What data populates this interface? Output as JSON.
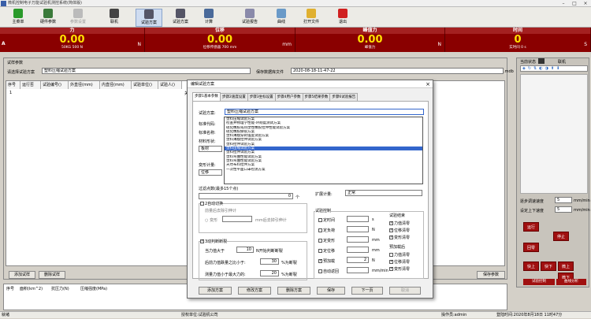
{
  "titlebar": {
    "title": "微机控制电子万能试验机测控系统(简体版)"
  },
  "toolbar": {
    "items": [
      {
        "label": "主菜单",
        "icon": "main-menu-icon"
      },
      {
        "label": "硬件参数",
        "icon": "hardware-icon"
      },
      {
        "label": "参数设置",
        "icon": "settings-icon"
      },
      {
        "label": "联机",
        "icon": "connect-icon"
      },
      {
        "label": "试验方案",
        "icon": "scheme-icon"
      },
      {
        "label": "试验方案",
        "icon": "scheme2-icon"
      },
      {
        "label": "计算",
        "icon": "calc-icon"
      },
      {
        "label": "试验报告",
        "icon": "report-icon"
      },
      {
        "label": "曲线",
        "icon": "curve-icon"
      },
      {
        "label": "打开文件",
        "icon": "folder-icon"
      },
      {
        "label": "退出",
        "icon": "exit-icon"
      }
    ]
  },
  "meters": {
    "force": {
      "title": "力",
      "value": "0.00",
      "unit": "N",
      "sub": "50KG 500 N",
      "ab": "A"
    },
    "disp": {
      "title": "位移",
      "value": "0.00",
      "unit": "mm",
      "sub": "位移传感器 700 mm"
    },
    "peak": {
      "title": "峰值力",
      "value": "0.00",
      "unit": "N",
      "sub": "峰值力"
    },
    "time": {
      "title": "时间",
      "value": "0",
      "unit": "S",
      "sub": "实时间 0 s"
    }
  },
  "params": {
    "group_label": "试样参数",
    "choose_label": "请选择试验方案",
    "scheme_value": "塑料压缩试验方案",
    "db_label": "保存数据库文件",
    "db_value": "2020-08-18-11-47-22",
    "db_ext": ".mdb"
  },
  "table": {
    "headers": [
      "序号",
      "运行否",
      "试验编号()",
      "外直径(mm)",
      "内直径(mm)",
      "试验单位()",
      "试验人()"
    ],
    "row1": "1",
    "stop_text": "关"
  },
  "bottom_buttons": {
    "add": "添加试样",
    "delete": "删除试样",
    "save_report": "保存参数"
  },
  "results": {
    "headers": [
      "序号",
      "面积(km^2)",
      "抗压力(N)",
      "压缩强度(MPa)"
    ]
  },
  "right_panel": {
    "status_label": "当前状态",
    "connect_label": "联机",
    "speed_label": "逐步调速速度",
    "speed_value": "5",
    "speed_unit": "mm/min",
    "upper_label": "设定上下速度",
    "upper_value": "5",
    "upper_unit": "mm/min",
    "btn_run": "运行",
    "btn_stop": "停止",
    "btn_return": "回零",
    "btn_up": "快上",
    "btn_down": "快下",
    "btn_fine_up": "微上",
    "btn_fine_down": "微下",
    "btn_trial": "试验控制",
    "btn_curve": "曲线分析"
  },
  "dialog": {
    "title": "编辑试验方案",
    "tabs": [
      "步骤1基本参数",
      "步骤2速度设置",
      "步骤3坐标设置",
      "步骤4用户参数",
      "步骤5结果参数",
      "步骤6试验报告"
    ],
    "scheme_label": "试验方案:",
    "scheme_value": "塑料压缩试验方案",
    "std_code_label": "标准代码:",
    "std_name_label": "标准名称:",
    "material_label": "材料形状:",
    "material_value": "板材",
    "deform_label": "变形计量:",
    "deform_value": "位移",
    "options": [
      "塑料压缩试验方案",
      "检查井物理学性能-环刚度测试方案",
      "硫化橡胶或热塑性橡胶拉伸性能试验方案",
      "硫化橡胶撕裂方案",
      "塑料薄膜穿刺强度试验方案",
      "塑料薄膜拉伸试验方案",
      "塑料拉伸试验方案",
      "塑料压缩试验方案",
      "塑料拉伸试验方案",
      "塑料弯曲性能试验方案",
      "塑料弯曲性能试验方案",
      "天然布料拉伸方案",
      "一次性平面口罩检测方案"
    ],
    "selected_index": 7,
    "filter_label": "过滤点数(最多15个点)",
    "filter_value": "0",
    "filter_unit": "个",
    "expand_label": "扩展计量:",
    "expand_value": "正常",
    "autocut_label": "2自动切换",
    "autocut_sub": "前量后去除引伸计",
    "autocut_mode": "变形",
    "autocut_unit": "mm后去掉引伸计",
    "break_label": "3动判断断裂",
    "break_force_label": "当力值大于",
    "break_force_value": "10",
    "break_force_unit": "N开始判断断裂",
    "break_drop_label": "后前力值跌量之比小于:",
    "break_drop_value": "30",
    "break_drop_unit": "%为断裂",
    "break_min_label": "测量力值小于最大力的:",
    "break_min_value": "20",
    "break_min_unit": "%为断裂",
    "test_ctrl_label": "试验控制",
    "test_end_label": "试验结束",
    "ctrl_items": [
      "定时间",
      "定负荷",
      "定变形",
      "定位移",
      "预加载",
      "自动返回"
    ],
    "ctrl_units": [
      "s",
      "N",
      "mm",
      "mm",
      "N",
      "mm/min"
    ],
    "preload_value": "2",
    "end_items": [
      "力值清零",
      "位移清零",
      "变形清零"
    ],
    "preload_label": "预加载后",
    "pre_items": [
      "力值清零",
      "位移清零",
      "变形清零"
    ],
    "buttons": [
      "添加方案",
      "修改方案",
      "删除方案",
      "保存",
      "下一页",
      "取消"
    ]
  },
  "status": {
    "left": "就绪",
    "company": "授权单位:试验机公司",
    "operator": "操作员:admin",
    "login_time": "登陆时间:2020年8月18日 11时47分",
    "version": "显示:"
  }
}
